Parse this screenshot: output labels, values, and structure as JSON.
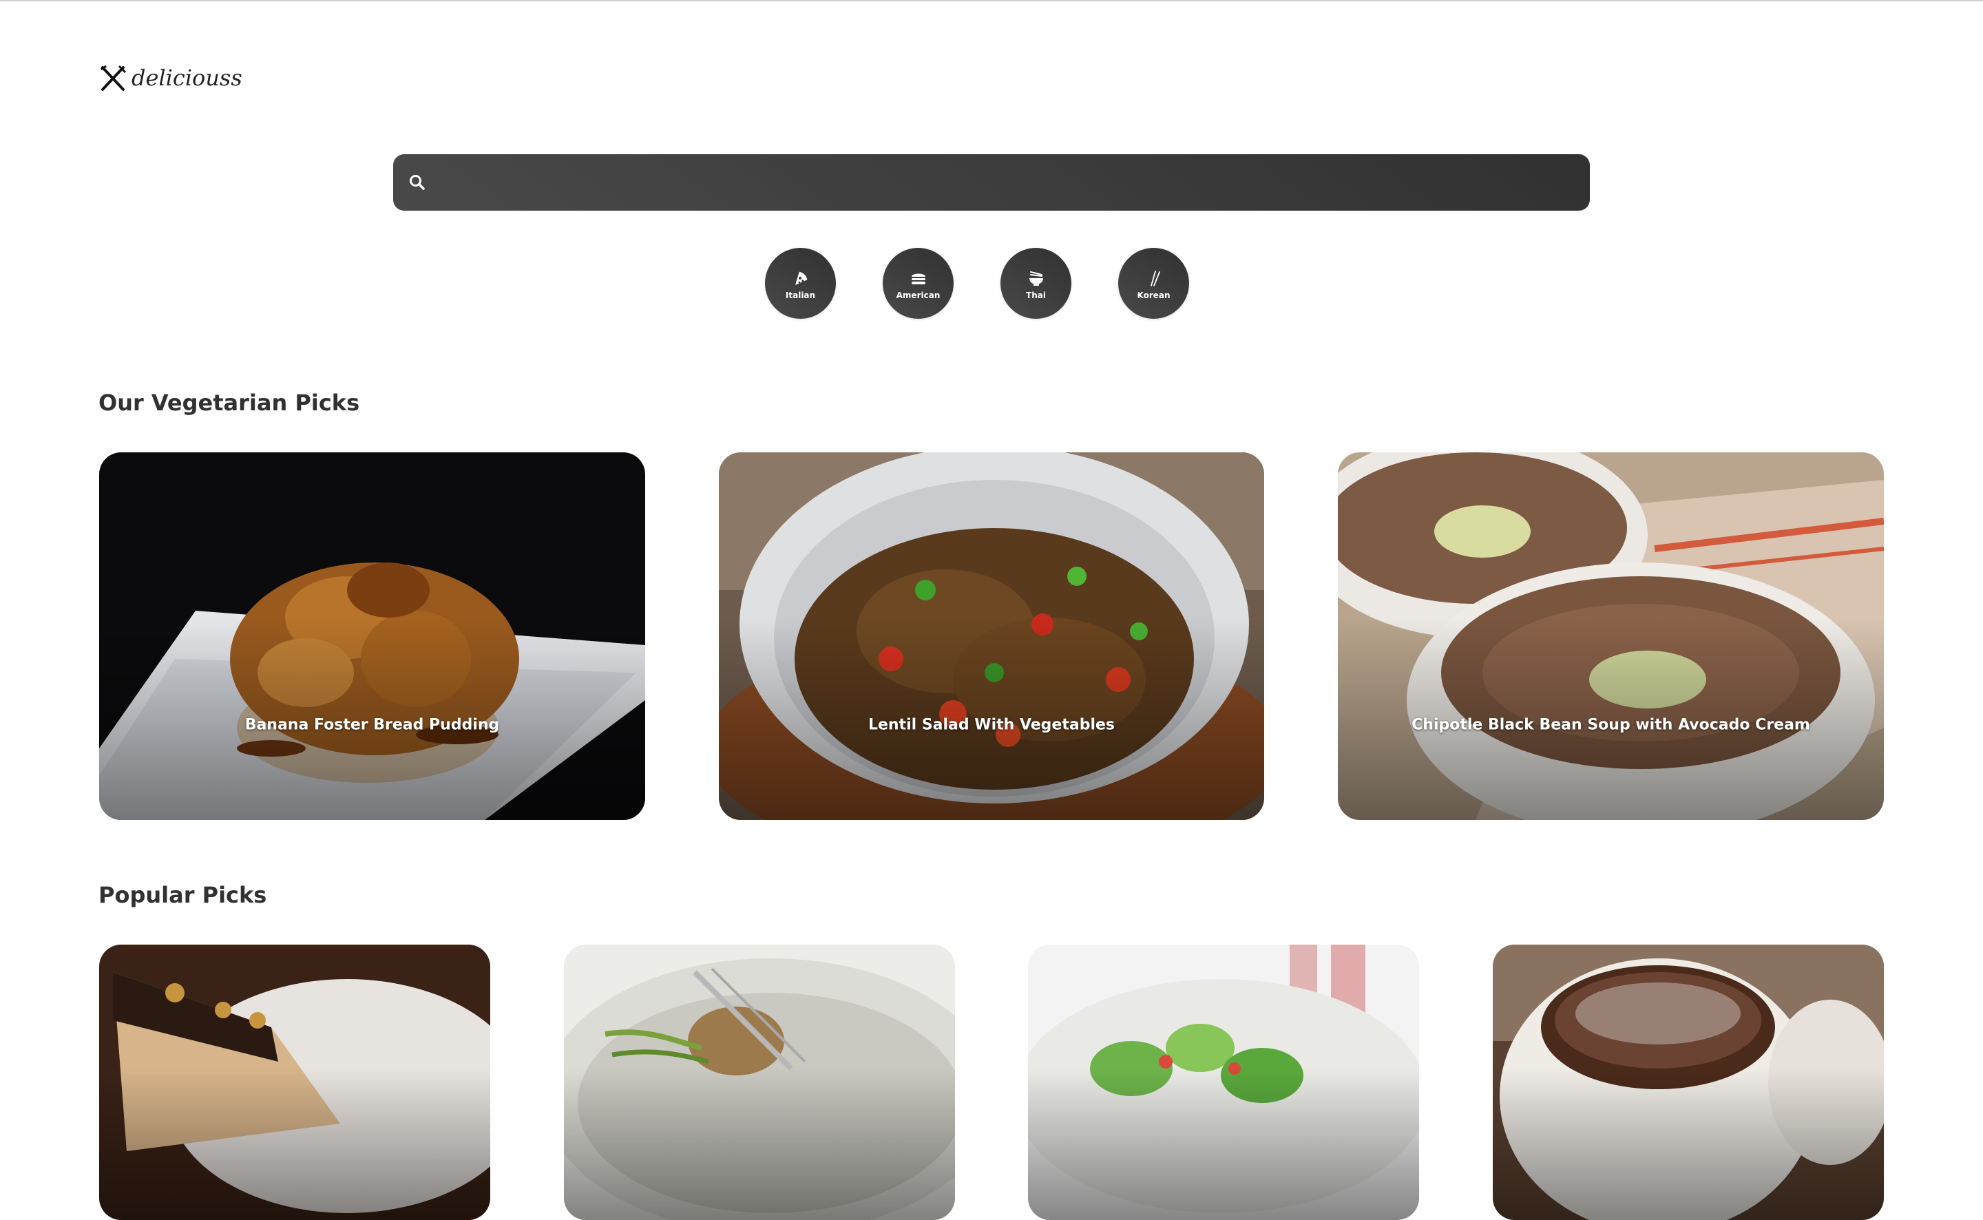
{
  "app": {
    "logo_text": "deliciouss",
    "logo_icon": "fork-knife-icon"
  },
  "search": {
    "value": "",
    "icon": "search-icon"
  },
  "cuisines": [
    {
      "label": "Italian",
      "icon": "pizza-icon"
    },
    {
      "label": "American",
      "icon": "burger-icon"
    },
    {
      "label": "Thai",
      "icon": "noodle-bowl-icon"
    },
    {
      "label": "Korean",
      "icon": "chopsticks-icon"
    }
  ],
  "vegetarian": {
    "heading": "Our Vegetarian Picks",
    "items": [
      {
        "title": "Banana Foster Bread Pudding"
      },
      {
        "title": "Lentil Salad With Vegetables"
      },
      {
        "title": "Chipotle Black Bean Soup with Avocado Cream"
      }
    ]
  },
  "popular": {
    "heading": "Popular Picks",
    "items": [
      {
        "title": ""
      },
      {
        "title": ""
      },
      {
        "title": ""
      },
      {
        "title": ""
      }
    ]
  },
  "colors": {
    "dark_button": "#313131",
    "button_gradient_light": "#494949",
    "heading_text": "#313131",
    "background": "#ffffff"
  }
}
